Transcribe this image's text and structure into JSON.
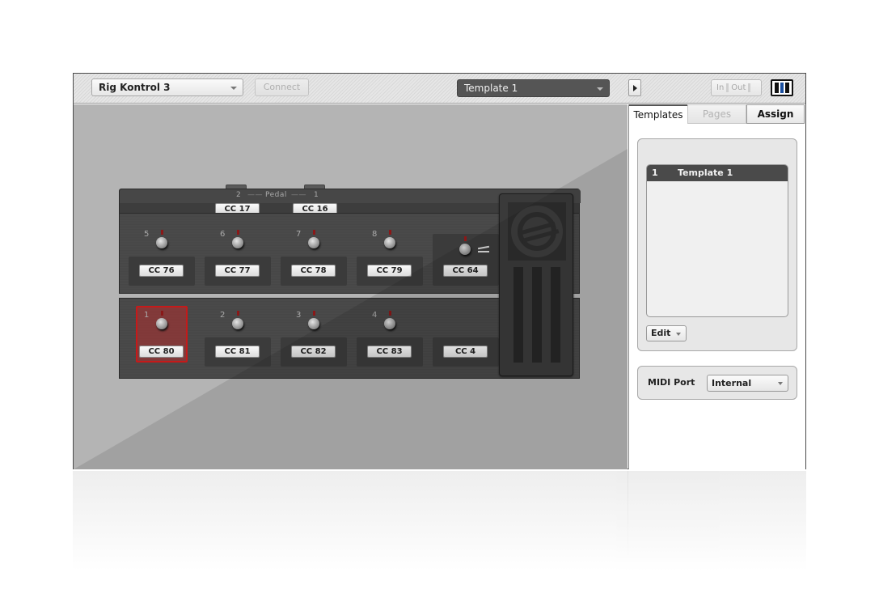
{
  "topbar": {
    "device_select": "Rig Kontrol 3",
    "connect_label": "Connect",
    "template_select": "Template 1",
    "in_label": "In",
    "out_label": "Out",
    "logo": "ni-logo"
  },
  "device": {
    "pedal_label": "Pedal",
    "pedal_left_num": "2",
    "pedal_right_num": "1",
    "pedal_cc": [
      "CC 17",
      "CC 16"
    ],
    "top_row": [
      {
        "num": "5",
        "cc": "CC 76"
      },
      {
        "num": "6",
        "cc": "CC 77"
      },
      {
        "num": "7",
        "cc": "CC 78"
      },
      {
        "num": "8",
        "cc": "CC 79"
      },
      {
        "num": "",
        "cc": "CC 64"
      }
    ],
    "bottom_row": [
      {
        "num": "1",
        "cc": "CC 80",
        "selected": true
      },
      {
        "num": "2",
        "cc": "CC 81"
      },
      {
        "num": "3",
        "cc": "CC 82"
      },
      {
        "num": "4",
        "cc": "CC 83"
      },
      {
        "num": "",
        "cc": "CC 4"
      }
    ],
    "selected_color": "#c51a1a"
  },
  "sidebar": {
    "tabs": [
      {
        "label": "Templates",
        "active": true
      },
      {
        "label": "Pages",
        "disabled": true
      },
      {
        "label": "Assign"
      }
    ],
    "templates": [
      {
        "index": "1",
        "name": "Template 1"
      }
    ],
    "edit_label": "Edit",
    "midi_port_label": "MIDI Port",
    "midi_port_value": "Internal"
  }
}
